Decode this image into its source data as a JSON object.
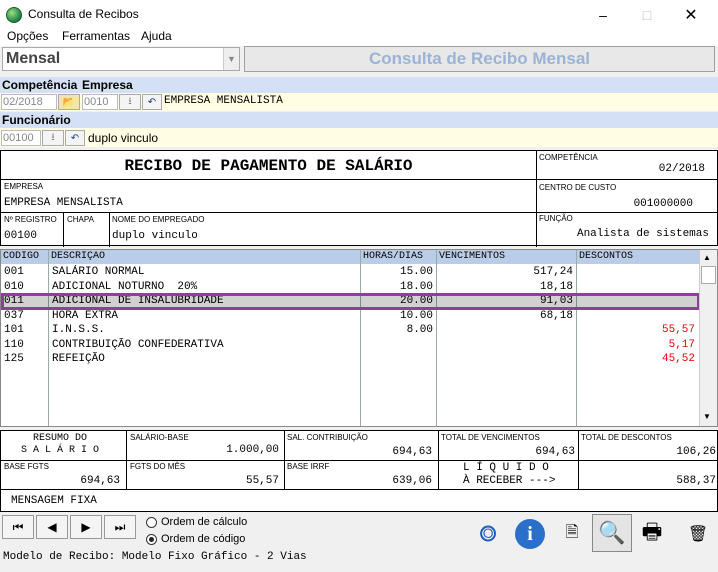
{
  "window": {
    "title": "Consulta de Recibos"
  },
  "menu": {
    "items": [
      "Opções",
      "Ferramentas",
      "Ajuda"
    ]
  },
  "toolbar": {
    "mode": "Mensal",
    "banner": "Consulta de Recibo Mensal"
  },
  "filters": {
    "competencia_label": "Competência",
    "empresa_label": "Empresa",
    "competencia": "02/2018",
    "empresa_code": "0010",
    "empresa_name": "EMPRESA MENSALISTA",
    "funcionario_label": "Funcionário",
    "funcionario_code": "00100",
    "funcionario_name": "duplo vinculo"
  },
  "receipt": {
    "title": "RECIBO DE PAGAMENTO DE SALÁRIO",
    "competencia_label": "COMPETÊNCIA",
    "competencia": "02/2018",
    "empresa_label": "EMPRESA",
    "empresa": "EMPRESA MENSALISTA",
    "centro_label": "CENTRO DE CUSTO",
    "centro": "001000000",
    "registro_label": "Nº REGISTRO",
    "registro": "00100",
    "chapa_label": "CHAPA",
    "nome_label": "NOME DO EMPREGADO",
    "nome": "duplo vinculo",
    "funcao_label": "FUNÇÃO",
    "funcao": "Analista de sistemas"
  },
  "grid": {
    "columns": [
      "CÓDIGO",
      "DESCRIÇÃO",
      "HORAS/DIAS",
      "VENCIMENTOS",
      "DESCONTOS"
    ],
    "rows": [
      {
        "code": "001",
        "desc": "SALÁRIO NORMAL",
        "hours": "15.00",
        "venc": "517,24",
        "desc_val": ""
      },
      {
        "code": "010",
        "desc": "ADICIONAL NOTURNO  20%",
        "hours": "18.00",
        "venc": "18,18",
        "desc_val": ""
      },
      {
        "code": "011",
        "desc": "ADICIONAL DE INSALUBRIDADE",
        "hours": "20.00",
        "venc": "91,03",
        "desc_val": ""
      },
      {
        "code": "037",
        "desc": "HORA EXTRA",
        "hours": "10.00",
        "venc": "68,18",
        "desc_val": ""
      },
      {
        "code": "101",
        "desc": "I.N.S.S.",
        "hours": "8.00",
        "venc": "",
        "desc_val": "55,57"
      },
      {
        "code": "110",
        "desc": "CONTRIBUIÇÃO CONFEDERATIVA",
        "hours": "",
        "venc": "",
        "desc_val": "5,17"
      },
      {
        "code": "125",
        "desc": "REFEIÇÃO",
        "hours": "",
        "venc": "",
        "desc_val": "45,52"
      }
    ],
    "selected_index": 2
  },
  "summary": {
    "resumo_l1": "RESUMO DO",
    "resumo_l2": "S A L Á R I O",
    "salario_base_label": "SALÁRIO-BASE",
    "salario_base": "1.000,00",
    "sal_contrib_label": "SAL. CONTRIBUIÇÃO",
    "sal_contrib": "694,63",
    "total_venc_label": "TOTAL DE VENCIMENTOS",
    "total_venc": "694,63",
    "total_desc_label": "TOTAL DE DESCONTOS",
    "total_desc": "106,26",
    "base_fgts_label": "BASE FGTS",
    "base_fgts": "694,63",
    "fgts_mes_label": "FGTS DO MÊS",
    "fgts_mes": "55,57",
    "base_irrf_label": "BASE IRRF",
    "base_irrf": "639,06",
    "liquido_l1": "L Í Q U I D O",
    "liquido_l2": "À RECEBER --->",
    "liquido": "588,37",
    "mensagem": "MENSAGEM FIXA"
  },
  "nav": {
    "order_calc": "Ordem de cálculo",
    "order_code": "Ordem de código",
    "selected_order": "code"
  },
  "status": {
    "text": "Modelo de Recibo: Modelo Fixo Gráfico - 2 Vias"
  },
  "colors": {
    "section": "#d3e0f5",
    "highlight": "#8e3f9a",
    "discount": "#e8000a"
  }
}
